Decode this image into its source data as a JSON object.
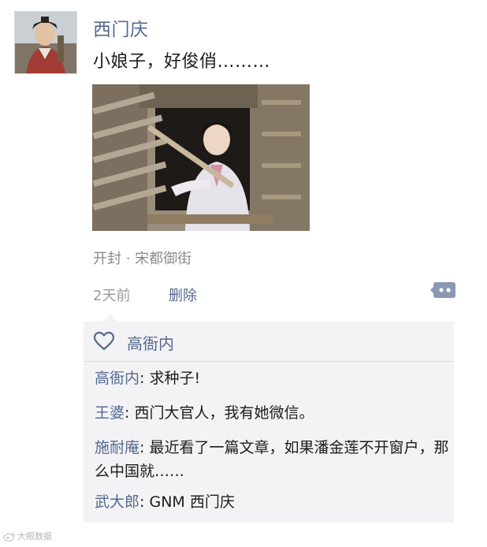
{
  "post": {
    "author": "西门庆",
    "text": "小娘子，好俊俏………",
    "location": "开封 · 宋都御街",
    "time": "2天前",
    "delete_label": "删除"
  },
  "likes": {
    "names": "高衙内"
  },
  "comments": [
    {
      "name": "高衙内",
      "sep": ": ",
      "text": "求种子!"
    },
    {
      "name": "王婆",
      "sep": ": ",
      "text": "西门大官人，我有她微信。"
    },
    {
      "name": "施耐庵",
      "sep": ": ",
      "text": "最近看了一篇文章，如果潘金莲不开窗户，那么中国就……"
    },
    {
      "name": "武大郎",
      "sep": ": ",
      "text": "GNM 西门庆"
    }
  ],
  "watermark": "大眼数据",
  "colors": {
    "name_link": "#55688f",
    "meta_gray": "#9a9a9a",
    "comment_bg": "#f3f3f5"
  },
  "icons": {
    "comment_button": "comment-bubble-icon",
    "like": "heart-outline-icon"
  }
}
